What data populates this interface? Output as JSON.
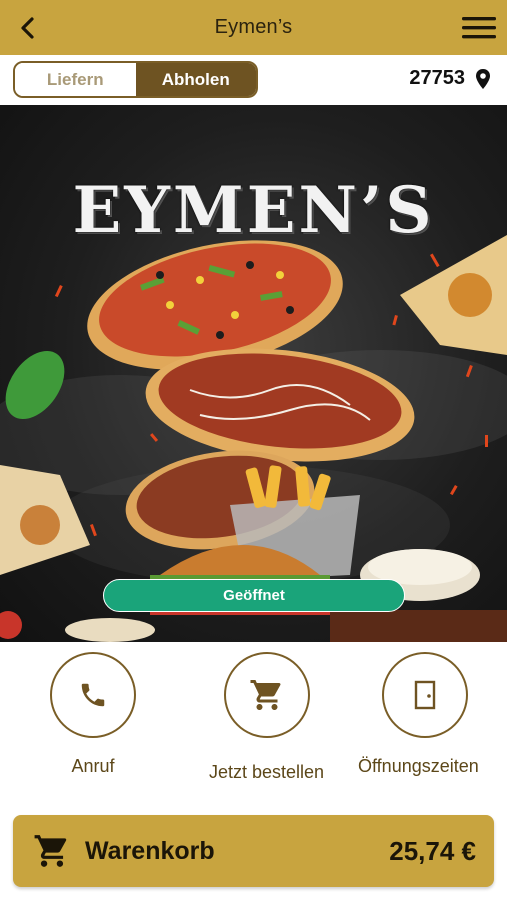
{
  "header": {
    "title": "Eymen’s",
    "back_icon": "chevron-left-icon",
    "menu_icon": "hamburger-menu-icon"
  },
  "mode_toggle": {
    "options": [
      "Liefern",
      "Abholen"
    ],
    "selected": "Abholen"
  },
  "location": {
    "zip": "27753",
    "icon": "location-pin-icon"
  },
  "hero": {
    "brand_text": "EYMEN’S",
    "status_label": "Geöffnet"
  },
  "actions": [
    {
      "label": "Anruf",
      "icon": "phone-icon"
    },
    {
      "label": "Jetzt bestellen",
      "icon": "shopping-cart-icon"
    },
    {
      "label": "Öffnungszeiten",
      "icon": "door-icon"
    }
  ],
  "cart": {
    "label": "Warenkorb",
    "total": "25,74 €",
    "icon": "shopping-cart-icon"
  },
  "colors": {
    "header_bg": "#c8a43f",
    "accent_brown": "#6e5322",
    "status_green": "#1aa47a"
  }
}
